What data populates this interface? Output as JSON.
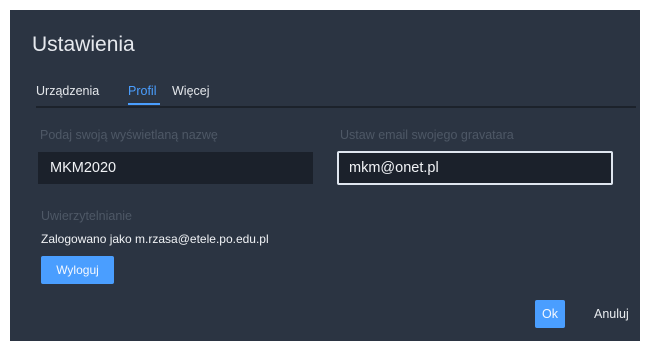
{
  "dialog": {
    "title": "Ustawienia",
    "tabs": [
      {
        "label": "Urządzenia",
        "active": false
      },
      {
        "label": "Profil",
        "active": true
      },
      {
        "label": "Więcej",
        "active": false
      }
    ]
  },
  "profile": {
    "display_name_label": "Podaj swoją wyświetlaną nazwę",
    "display_name_value": "MKM2020",
    "gravatar_label": "Ustaw email swojego gravatara",
    "gravatar_value": "mkm@onet.pl",
    "auth_label": "Uwierzytelnianie",
    "auth_status": "Zalogowano jako m.rzasa@etele.po.edu.pl",
    "logout_label": "Wyloguj"
  },
  "footer": {
    "ok_label": "Ok",
    "cancel_label": "Anuluj"
  },
  "colors": {
    "accent": "#4a9eff",
    "dialog_bg": "#2b3442",
    "input_bg": "#1b212b"
  }
}
